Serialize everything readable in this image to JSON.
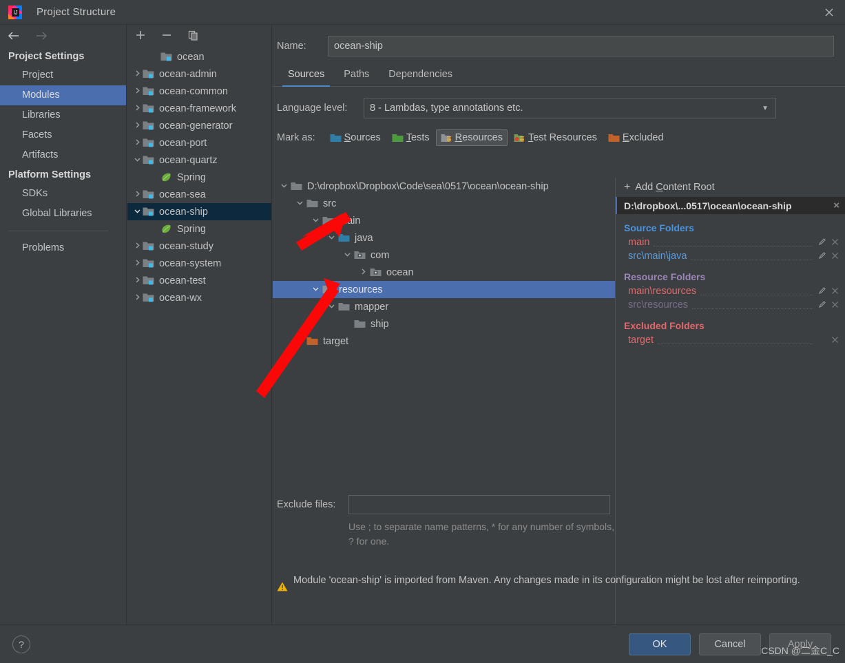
{
  "window": {
    "title": "Project Structure",
    "app_icon": "intellij-idea-icon",
    "close_icon": "close-icon"
  },
  "sidebar": {
    "back_icon": "arrow-left-icon",
    "forward_icon": "arrow-right-icon",
    "groups": [
      {
        "title": "Project Settings",
        "items": [
          {
            "label": "Project",
            "selected": false
          },
          {
            "label": "Modules",
            "selected": true
          },
          {
            "label": "Libraries",
            "selected": false
          },
          {
            "label": "Facets",
            "selected": false
          },
          {
            "label": "Artifacts",
            "selected": false
          }
        ]
      },
      {
        "title": "Platform Settings",
        "items": [
          {
            "label": "SDKs",
            "selected": false
          },
          {
            "label": "Global Libraries",
            "selected": false
          }
        ]
      }
    ],
    "problems_label": "Problems"
  },
  "modules_panel": {
    "toolbar": {
      "add_label": "+",
      "remove_label": "−",
      "copy_icon": "copy-icon"
    },
    "modules": [
      {
        "label": "ocean",
        "indent": 1,
        "twisty": "",
        "icon": "module-icon",
        "selected": false
      },
      {
        "label": "ocean-admin",
        "indent": 0,
        "twisty": ">",
        "icon": "module-icon",
        "selected": false
      },
      {
        "label": "ocean-common",
        "indent": 0,
        "twisty": ">",
        "icon": "module-icon",
        "selected": false
      },
      {
        "label": "ocean-framework",
        "indent": 0,
        "twisty": ">",
        "icon": "module-icon",
        "selected": false
      },
      {
        "label": "ocean-generator",
        "indent": 0,
        "twisty": ">",
        "icon": "module-icon",
        "selected": false
      },
      {
        "label": "ocean-port",
        "indent": 0,
        "twisty": ">",
        "icon": "module-icon",
        "selected": false
      },
      {
        "label": "ocean-quartz",
        "indent": 0,
        "twisty": "v",
        "icon": "module-icon",
        "selected": false
      },
      {
        "label": "Spring",
        "indent": 1,
        "twisty": "",
        "icon": "spring-icon",
        "selected": false
      },
      {
        "label": "ocean-sea",
        "indent": 0,
        "twisty": ">",
        "icon": "module-icon",
        "selected": false
      },
      {
        "label": "ocean-ship",
        "indent": 0,
        "twisty": "v",
        "icon": "module-icon",
        "selected": true
      },
      {
        "label": "Spring",
        "indent": 1,
        "twisty": "",
        "icon": "spring-icon",
        "selected": false
      },
      {
        "label": "ocean-study",
        "indent": 0,
        "twisty": ">",
        "icon": "module-icon",
        "selected": false
      },
      {
        "label": "ocean-system",
        "indent": 0,
        "twisty": ">",
        "icon": "module-icon",
        "selected": false
      },
      {
        "label": "ocean-test",
        "indent": 0,
        "twisty": ">",
        "icon": "module-icon",
        "selected": false
      },
      {
        "label": "ocean-wx",
        "indent": 0,
        "twisty": ">",
        "icon": "module-icon",
        "selected": false
      }
    ]
  },
  "main": {
    "name_label": "Name:",
    "name_value": "ocean-ship",
    "name_placeholder": "",
    "tabs": [
      {
        "label": "Sources",
        "active": true
      },
      {
        "label": "Paths",
        "active": false
      },
      {
        "label": "Dependencies",
        "active": false
      }
    ],
    "language_level_label": "Language level:",
    "language_level_value": "8 - Lambdas, type annotations etc.",
    "language_level_caret": "chevron-down-icon",
    "mark_as_label": "Mark as:",
    "mark_buttons": [
      {
        "label": "Sources",
        "mnemonic": "S",
        "rest": "ources",
        "icon": "sources-folder-icon",
        "color": "#2e7ea8",
        "pressed": false
      },
      {
        "label": "Tests",
        "mnemonic": "T",
        "rest": "ests",
        "icon": "tests-folder-icon",
        "color": "#4e9a3e",
        "pressed": false
      },
      {
        "label": "Resources",
        "mnemonic": "R",
        "rest": "esources",
        "icon": "resources-folder-icon",
        "color": "#8f9396",
        "pressed": true
      },
      {
        "label": "Test Resources",
        "mnemonic": "T",
        "rest": "est Resources",
        "icon": "test-resources-folder-icon",
        "color": "#6f9a56",
        "pressed": false
      },
      {
        "label": "Excluded",
        "mnemonic": "E",
        "rest": "xcluded",
        "icon": "excluded-folder-icon",
        "color": "#c0622a",
        "pressed": false
      }
    ],
    "tree": [
      {
        "label": "D:\\dropbox\\Dropbox\\Code\\sea\\0517\\ocean\\ocean-ship",
        "depth": 0,
        "twisty": "v",
        "icon": "folder-icon",
        "selected": false
      },
      {
        "label": "src",
        "depth": 1,
        "twisty": "v",
        "icon": "folder-icon",
        "selected": false
      },
      {
        "label": "main",
        "depth": 2,
        "twisty": "v",
        "icon": "folder-icon",
        "selected": false
      },
      {
        "label": "java",
        "depth": 3,
        "twisty": "v",
        "icon": "sources-folder-icon",
        "selected": false
      },
      {
        "label": "com",
        "depth": 4,
        "twisty": "v",
        "icon": "package-icon",
        "selected": false
      },
      {
        "label": "ocean",
        "depth": 5,
        "twisty": ">",
        "icon": "package-icon",
        "selected": false
      },
      {
        "label": "resources",
        "depth": 2,
        "twisty": "v",
        "icon": "resources-folder-icon",
        "selected": true
      },
      {
        "label": "mapper",
        "depth": 3,
        "twisty": "v",
        "icon": "folder-icon",
        "selected": false
      },
      {
        "label": "ship",
        "depth": 4,
        "twisty": "",
        "icon": "folder-icon",
        "selected": false
      },
      {
        "label": "target",
        "depth": 1,
        "twisty": ">",
        "icon": "excluded-folder-icon",
        "selected": false
      }
    ],
    "exclude_files_label": "Exclude files:",
    "exclude_files_value": "",
    "exclude_hint": "Use ; to separate name patterns, * for any number of symbols, ? for one.",
    "notice_icon": "warning-icon",
    "notice_text": "Module 'ocean-ship' is imported from Maven. Any changes made in its configuration might be lost after reimporting."
  },
  "roots": {
    "add_content_root": {
      "prefix": "Add ",
      "mnemonic": "C",
      "rest": "ontent Root",
      "plus": "+"
    },
    "content_root_path": "D:\\dropbox\\...0517\\ocean\\ocean-ship",
    "content_root_close": "×",
    "sections": [
      {
        "title": "Source Folders",
        "kind": "src",
        "folders": [
          {
            "path": "main",
            "color_class": "c-red",
            "has_edit": true,
            "has_remove": true
          },
          {
            "path": "src\\main\\java",
            "color_class": "c-blue",
            "has_edit": true,
            "has_remove": true
          }
        ]
      },
      {
        "title": "Resource Folders",
        "kind": "res",
        "folders": [
          {
            "path": "main\\resources",
            "color_class": "c-red",
            "has_edit": true,
            "has_remove": true
          },
          {
            "path": "src\\resources",
            "color_class": "c-dim-purple",
            "has_edit": true,
            "has_remove": true
          }
        ]
      },
      {
        "title": "Excluded Folders",
        "kind": "exc",
        "folders": [
          {
            "path": "target",
            "color_class": "c-pink",
            "has_edit": false,
            "has_remove": true
          }
        ]
      }
    ],
    "edit_icon": "pencil-icon",
    "remove_icon": "close-icon"
  },
  "bottom": {
    "help_label": "?",
    "ok_label": "OK",
    "cancel_label": "Cancel",
    "apply_label": "Apply"
  },
  "watermark": "CSDN @二金C_C",
  "colors": {
    "accent_selection": "#4b6eaf",
    "tree_selection": "#4b6eaf",
    "module_selection": "#0d293e",
    "ok_button": "#365880",
    "tab_underline": "#4a88c7",
    "annotation_arrow": "#fb0707",
    "source_blue": "#4a92de",
    "resource_purple": "#9b86b7",
    "excluded_red": "#e2686c"
  }
}
